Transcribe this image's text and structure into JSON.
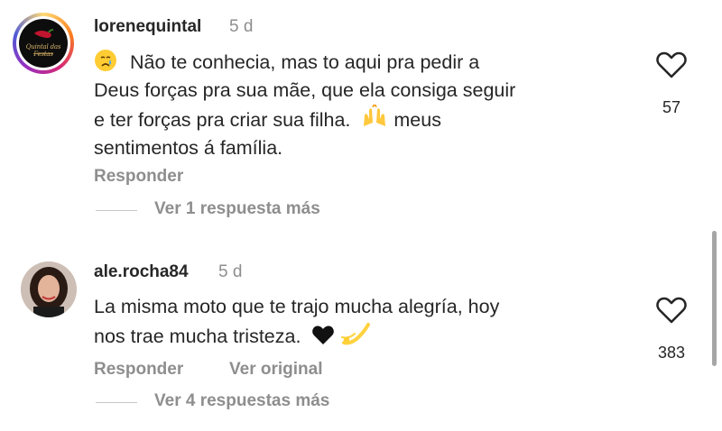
{
  "comments": [
    {
      "username": "lorenequintal",
      "time": "5 d",
      "avatar_text": "Quintal das Festas",
      "text_lines": [
        "Não te conhecia, mas to aqui pra pedir a",
        "Deus forças pra sua mãe, que ela consiga seguir",
        "e ter forças pra criar sua filha.",
        " meus",
        "sentimentos á família."
      ],
      "reply_label": "Responder",
      "view_replies": "Ver 1 respuesta más",
      "likes": "57",
      "emojis": [
        "crying-face",
        "raising-hands"
      ]
    },
    {
      "username": "ale.rocha84",
      "time": "5 d",
      "text_lines": [
        "La misma moto que te trajo mucha alegría, hoy",
        "nos trae mucha tristeza."
      ],
      "reply_label": "Responder",
      "original_label": "Ver original",
      "view_replies": "Ver 4 respuestas más",
      "likes": "383",
      "emojis": [
        "black-heart",
        "dizzy"
      ]
    }
  ],
  "colors": {
    "text": "#262626",
    "muted": "#8e8e8e",
    "ring": "#d62976"
  }
}
